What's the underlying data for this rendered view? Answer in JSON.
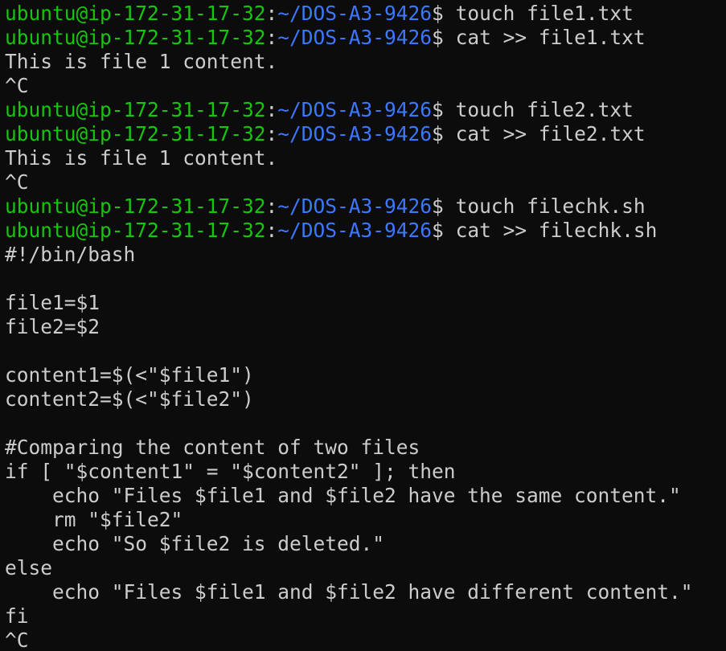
{
  "terminal": {
    "colors": {
      "background": "#0c0c0c",
      "user_host": "#16c60c",
      "path": "#3b78ff",
      "text": "#cccccc"
    },
    "prompt": {
      "user_host": "ubuntu@ip-172-31-17-32",
      "colon": ":",
      "path": "~/DOS-A3-9426",
      "dollar": "$"
    },
    "lines": [
      {
        "type": "prompt",
        "command": " touch file1.txt"
      },
      {
        "type": "prompt",
        "command": " cat >> file1.txt"
      },
      {
        "type": "output",
        "text": "This is file 1 content."
      },
      {
        "type": "output",
        "text": "^C"
      },
      {
        "type": "prompt",
        "command": " touch file2.txt"
      },
      {
        "type": "prompt",
        "command": " cat >> file2.txt"
      },
      {
        "type": "output",
        "text": "This is file 1 content."
      },
      {
        "type": "output",
        "text": "^C"
      },
      {
        "type": "prompt",
        "command": " touch filechk.sh"
      },
      {
        "type": "prompt",
        "command": " cat >> filechk.sh"
      },
      {
        "type": "output",
        "text": "#!/bin/bash"
      },
      {
        "type": "output",
        "text": ""
      },
      {
        "type": "output",
        "text": "file1=$1"
      },
      {
        "type": "output",
        "text": "file2=$2"
      },
      {
        "type": "output",
        "text": ""
      },
      {
        "type": "output",
        "text": "content1=$(<\"$file1\")"
      },
      {
        "type": "output",
        "text": "content2=$(<\"$file2\")"
      },
      {
        "type": "output",
        "text": ""
      },
      {
        "type": "output",
        "text": "#Comparing the content of two files"
      },
      {
        "type": "output",
        "text": "if [ \"$content1\" = \"$content2\" ]; then"
      },
      {
        "type": "output",
        "text": "    echo \"Files $file1 and $file2 have the same content.\""
      },
      {
        "type": "output",
        "text": "    rm \"$file2\""
      },
      {
        "type": "output",
        "text": "    echo \"So $file2 is deleted.\""
      },
      {
        "type": "output",
        "text": "else"
      },
      {
        "type": "output",
        "text": "    echo \"Files $file1 and $file2 have different content.\""
      },
      {
        "type": "output",
        "text": "fi"
      },
      {
        "type": "output",
        "text": "^C"
      }
    ]
  }
}
